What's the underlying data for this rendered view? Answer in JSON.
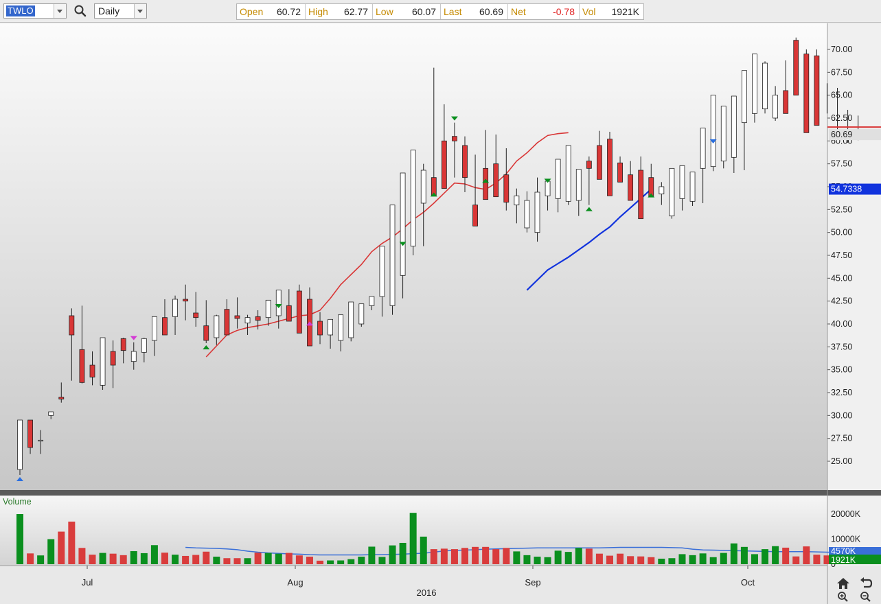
{
  "toolbar": {
    "symbol": "TWLO",
    "period": "Daily",
    "quote": [
      {
        "label": "Open",
        "value": "60.72",
        "negative": false
      },
      {
        "label": "High",
        "value": "62.77",
        "negative": false
      },
      {
        "label": "Low",
        "value": "60.07",
        "negative": false
      },
      {
        "label": "Last",
        "value": "60.69",
        "negative": false
      },
      {
        "label": "Net",
        "value": "-0.78",
        "negative": true
      },
      {
        "label": "Vol",
        "value": "1921K",
        "negative": false
      }
    ]
  },
  "price_axis": {
    "ticks": [
      "70.00",
      "67.50",
      "65.00",
      "62.50",
      "60.00",
      "57.50",
      "55.00",
      "52.50",
      "50.00",
      "47.50",
      "45.00",
      "42.50",
      "40.00",
      "37.50",
      "35.00",
      "32.50",
      "30.00",
      "27.50",
      "25.00"
    ],
    "last_badge": "60.69",
    "ma_badge": "54.7338"
  },
  "volume_axis": {
    "title": "Volume",
    "ticks": [
      "20000K",
      "10000K",
      "0"
    ],
    "avg_badge": "4570K",
    "last_badge": "1921K"
  },
  "x_axis": {
    "months": [
      "Jul",
      "Aug",
      "Sep",
      "Oct"
    ],
    "year": "2016"
  },
  "colors": {
    "up": "#ffffff",
    "down": "#d93636",
    "ma_short": "#d93636",
    "ma_long": "#1133dd",
    "vol_up": "#0a8f1e",
    "vol_down": "#d93c3c",
    "vol_avg": "#3a6fd8",
    "marker_green": "#0a8f1e",
    "marker_blue": "#2a6fe0",
    "marker_magenta": "#d43ad4"
  },
  "chart_data": {
    "type": "candlestick",
    "symbol": "TWLO",
    "interval": "Daily",
    "ylim": [
      22.5,
      72.5
    ],
    "x_labels": [
      "Jul",
      "Aug",
      "Sep",
      "Oct",
      "2016"
    ],
    "series": [
      {
        "name": "Open",
        "values": [
          24.1,
          29.5,
          27.2,
          30.0,
          32.0,
          40.9,
          37.2,
          35.5,
          33.3,
          37.0,
          38.4,
          35.9,
          36.9,
          38.2,
          40.7,
          40.8,
          42.7,
          41.2,
          39.8,
          38.5,
          41.6,
          40.9,
          40.1,
          40.8,
          40.7,
          40.9,
          42.0,
          43.6,
          42.7,
          40.3,
          38.8,
          38.2,
          38.5,
          40.0,
          42.0,
          43.0,
          42.0,
          45.3,
          48.5,
          53.2,
          56.0,
          60.0,
          60.5,
          59.5,
          53.0,
          57.0,
          57.5,
          56.3,
          53.0,
          50.5,
          50.0,
          54.0,
          53.7,
          53.4,
          53.5,
          57.8,
          59.5,
          60.2,
          57.6,
          56.3,
          56.8,
          56.0,
          54.2,
          51.8,
          53.7,
          53.4,
          57.0,
          57.2,
          57.8,
          58.2,
          62.0,
          63.0,
          63.5,
          62.5,
          65.5,
          71.0,
          69.5,
          69.3,
          65.0,
          62.7,
          61.2,
          60.9
        ],
        "note": "approximate readings"
      },
      {
        "name": "High",
        "values": [
          29.5,
          28.8,
          28.4,
          30.4,
          33.6,
          41.7,
          42.0,
          37.0,
          36.0,
          38.2,
          38.5,
          38.0,
          38.5,
          40.0,
          42.7,
          43.1,
          44.3,
          43.5,
          42.6,
          41.0,
          42.7,
          42.9,
          41.0,
          41.5,
          42.3,
          41.5,
          43.8,
          44.3,
          44.0,
          41.3,
          39.8,
          39.3,
          40.5,
          41.4,
          42.3,
          43.5,
          45.6,
          48.3,
          55.0,
          57.5,
          68.0,
          64.0,
          62.0,
          60.5,
          58.5,
          61.2,
          60.7,
          59.2,
          54.8,
          54.5,
          56.0,
          55.2,
          54.6,
          53.8,
          55.7,
          58.3,
          61.1,
          61.0,
          58.3,
          57.8,
          58.3,
          57.5,
          55.5,
          54.6,
          55.0,
          55.3,
          57.8,
          59.5,
          59.8,
          59.0,
          62.2,
          66.5,
          68.7,
          66.0,
          68.8,
          71.3,
          70.0,
          70.0,
          66.3,
          65.8,
          63.4,
          62.77
        ]
      },
      {
        "name": "Low",
        "values": [
          23.5,
          25.8,
          25.8,
          29.6,
          31.4,
          33.8,
          33.5,
          33.3,
          32.8,
          33.0,
          35.7,
          35.0,
          35.8,
          36.5,
          40.0,
          38.8,
          40.4,
          39.7,
          37.9,
          37.7,
          39.6,
          39.5,
          38.8,
          39.4,
          39.8,
          39.5,
          40.8,
          41.2,
          40.5,
          37.8,
          37.3,
          37.0,
          38.1,
          39.7,
          41.5,
          40.8,
          41.0,
          42.8,
          47.5,
          48.5,
          54.6,
          57.0,
          56.0,
          54.4,
          52.7,
          56.1,
          55.4,
          52.4,
          51.0,
          50.0,
          49.0,
          52.4,
          52.2,
          53.0,
          51.8,
          53.0,
          57.8,
          57.2,
          56.5,
          55.5,
          55.0,
          54.5,
          53.0,
          51.5,
          52.4,
          52.9,
          53.2,
          56.7,
          57.0,
          56.5,
          56.8,
          62.0,
          63.0,
          62.2,
          64.5,
          67.3,
          68.5,
          65.8,
          63.0,
          60.9,
          59.8,
          60.07
        ]
      },
      {
        "name": "Close",
        "values": [
          29.5,
          26.5,
          27.3,
          30.4,
          31.8,
          38.8,
          33.6,
          34.2,
          38.5,
          35.5,
          37.1,
          37.0,
          38.4,
          40.8,
          38.8,
          42.7,
          42.5,
          40.7,
          38.2,
          40.9,
          38.8,
          40.6,
          40.7,
          40.4,
          42.6,
          43.7,
          40.3,
          39.0,
          37.6,
          38.8,
          40.5,
          41.0,
          42.4,
          42.2,
          43.0,
          48.5,
          53.0,
          56.5,
          59.0,
          56.8,
          54.0,
          54.8,
          60.0,
          56.0,
          50.7,
          53.6,
          53.9,
          53.3,
          54.0,
          53.5,
          54.4,
          55.6,
          58.0,
          59.5,
          56.9,
          57.0,
          55.8,
          54.0,
          55.5,
          53.5,
          51.5,
          53.9,
          55.0,
          57.0,
          57.3,
          56.6,
          61.4,
          65.0,
          63.8,
          64.9,
          67.7,
          69.5,
          68.5,
          65.0,
          63.0,
          65.0,
          60.9,
          61.7
        ]
      },
      {
        "name": "20-day MA",
        "values": [
          36.4,
          37.6,
          38.8,
          39.3,
          39.6,
          39.8,
          40.0,
          40.3,
          40.6,
          40.9,
          41.0,
          41.5,
          42.8,
          44.3,
          45.4,
          46.5,
          47.9,
          48.8,
          49.5,
          50.4,
          51.4,
          52.2,
          53.2,
          54.3,
          55.4,
          55.3,
          54.9,
          54.7,
          55.4,
          56.4,
          57.8,
          58.7,
          59.8,
          60.6,
          60.8,
          60.9
        ],
        "start_index": 18
      },
      {
        "name": "50-day MA",
        "values": [
          43.7,
          44.8,
          45.9,
          46.6,
          47.3,
          48.1,
          48.9,
          49.8,
          50.6,
          51.7,
          52.7,
          53.7,
          54.7338
        ],
        "start_index": 49
      },
      {
        "name": "Volume",
        "values": [
          20000,
          4300,
          3500,
          10000,
          13000,
          17000,
          6500,
          3800,
          4500,
          4200,
          3600,
          5200,
          4400,
          7600,
          4600,
          3800,
          3300,
          3700,
          5000,
          3000,
          2400,
          2400,
          2400,
          4600,
          4500,
          4200,
          4500,
          3500,
          3000,
          1400,
          1500,
          1500,
          2000,
          3000,
          7000,
          2900,
          7500,
          8500,
          20500,
          11000,
          6000,
          6200,
          6000,
          6500,
          6900,
          6900,
          6000,
          6500,
          5100,
          3600,
          3000,
          2800,
          5400,
          4900,
          6500,
          6200,
          4200,
          3400,
          4200,
          3200,
          3100,
          2800,
          2200,
          2400,
          4000,
          3600,
          4300,
          2800,
          4500,
          8300,
          6900,
          4000,
          6000,
          7200,
          6600,
          3100,
          7100,
          3800,
          3500,
          2300,
          2200,
          1921
        ]
      },
      {
        "name": "Volume MA",
        "values": [
          6700,
          6500,
          6400,
          6300,
          6100,
          5800,
          5200,
          4800,
          4500,
          4300,
          4100,
          4000,
          3800,
          3700,
          3700,
          3700,
          3700,
          3700,
          3800,
          3800,
          3900,
          4000,
          4200,
          4400,
          4800,
          5300,
          5500,
          5600,
          5800,
          6000,
          6100,
          6200,
          6300,
          6400,
          6500,
          6500,
          6500,
          6500,
          6500,
          6500,
          6500,
          6600,
          6700,
          6700,
          6700,
          6700,
          6700,
          6600,
          6500,
          6000,
          5700,
          5600,
          5500,
          5400,
          5300,
          5200,
          5100,
          5000,
          5000,
          5000,
          5000,
          4900,
          4800,
          4700,
          4650,
          4600,
          4570
        ],
        "start_index": 16
      }
    ],
    "signal_markers": {
      "peak_down": [
        11,
        25,
        37,
        42,
        51,
        67
      ],
      "trough_up": [
        0,
        18,
        28,
        40,
        45,
        55,
        61
      ]
    }
  }
}
